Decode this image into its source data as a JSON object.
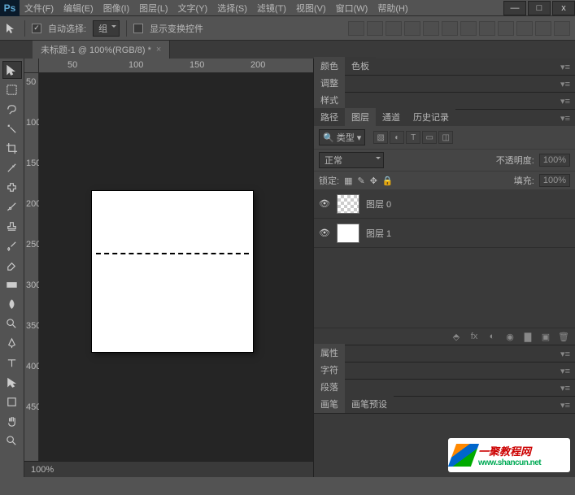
{
  "app": {
    "logo": "Ps"
  },
  "menu": [
    "文件(F)",
    "编辑(E)",
    "图像(I)",
    "图层(L)",
    "文字(Y)",
    "选择(S)",
    "滤镜(T)",
    "视图(V)",
    "窗口(W)",
    "帮助(H)"
  ],
  "window_controls": {
    "min": "—",
    "max": "□",
    "close": "x"
  },
  "options": {
    "auto_select": "自动选择:",
    "group": "组",
    "show_transform": "显示变换控件"
  },
  "document": {
    "tab_title": "未标题-1 @ 100%(RGB/8) *",
    "zoom": "100%"
  },
  "ruler_h": [
    "50",
    "100",
    "150",
    "200"
  ],
  "ruler_v": [
    "50",
    "100",
    "150",
    "200",
    "250",
    "300",
    "350",
    "400",
    "450"
  ],
  "panels": {
    "color_tabs": [
      "颜色",
      "色板"
    ],
    "adjust": "调整",
    "style": "样式",
    "layer_tabs": [
      "路径",
      "图层",
      "通道",
      "历史记录"
    ],
    "kind": "类型",
    "blend_mode": "正常",
    "opacity_label": "不透明度:",
    "opacity_value": "100%",
    "lock_label": "锁定:",
    "fill_label": "填充:",
    "fill_value": "100%",
    "layers": [
      {
        "name": "图层 0",
        "transparent": true
      },
      {
        "name": "图层 1",
        "transparent": false
      }
    ],
    "props": "属性",
    "char": "字符",
    "para": "段落",
    "brush_tabs": [
      "画笔",
      "画笔预设"
    ]
  },
  "watermark": {
    "brand": "一聚教程网",
    "url": "www.shancun.net"
  }
}
